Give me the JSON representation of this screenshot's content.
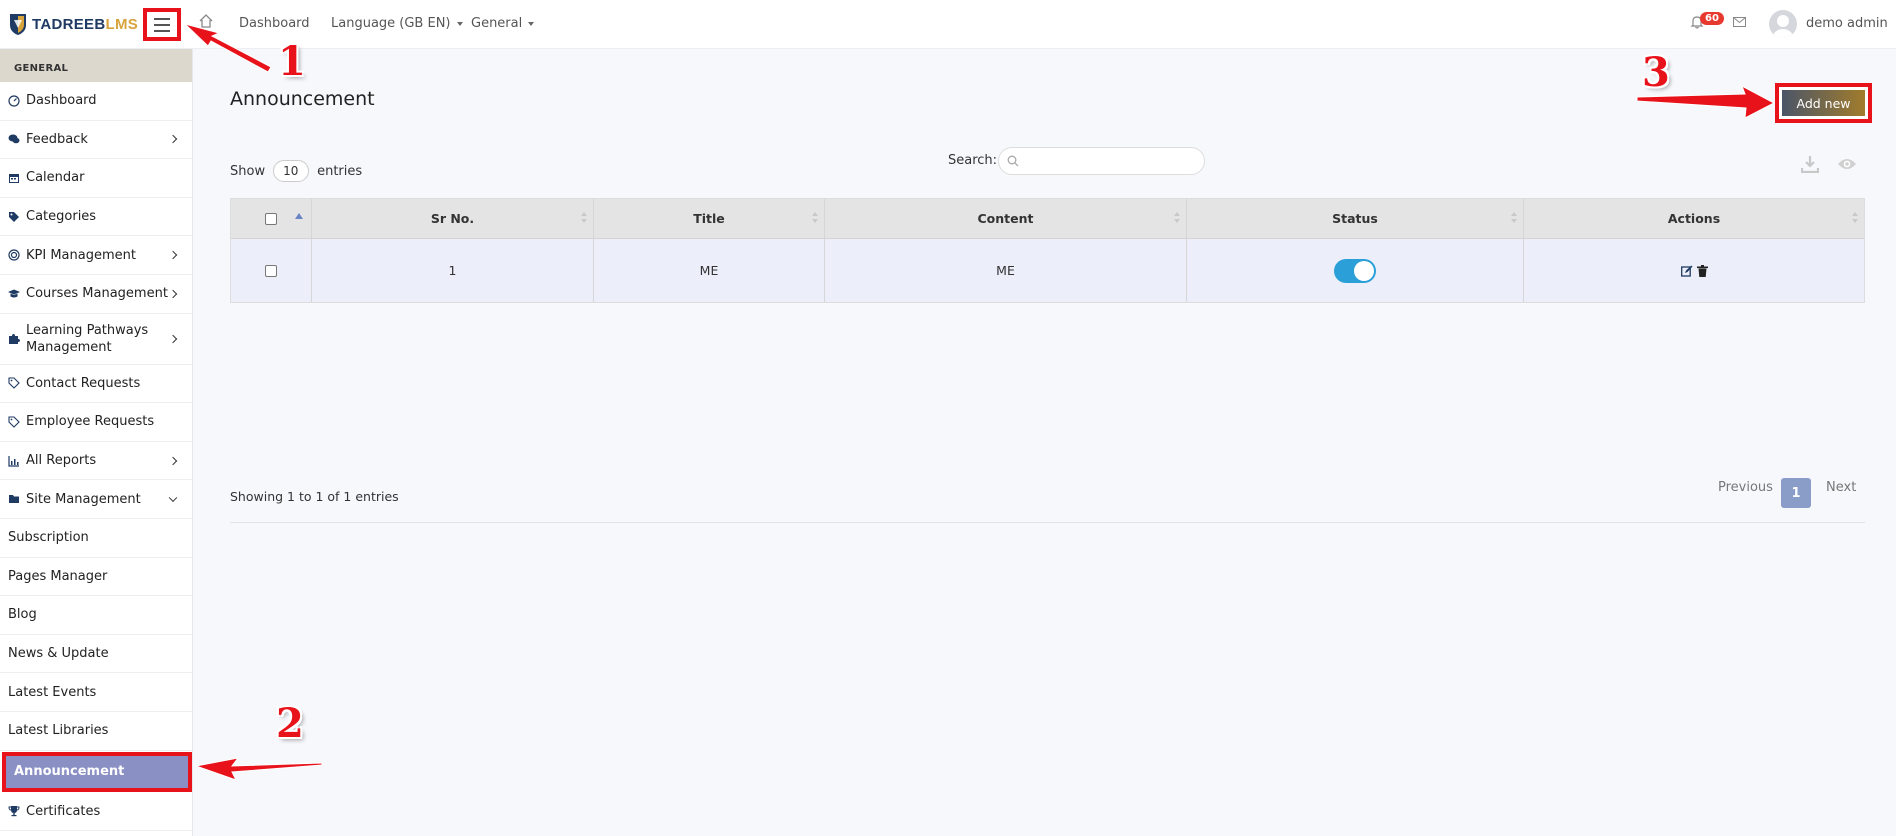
{
  "brand": {
    "part1": "TADREEB",
    "part2": "LMS"
  },
  "topnav": {
    "items": [
      "Dashboard",
      "Language (GB EN)",
      "General"
    ],
    "notifications_count": "60",
    "user_name": "demo admin"
  },
  "sidebar": {
    "section": "GENERAL",
    "items": [
      {
        "label": "Dashboard",
        "icon": "gauge-icon",
        "submenu": false
      },
      {
        "label": "Feedback",
        "icon": "comments-icon",
        "submenu": true
      },
      {
        "label": "Calendar",
        "icon": "calendar-icon",
        "submenu": false
      },
      {
        "label": "Categories",
        "icon": "tags-icon",
        "submenu": false
      },
      {
        "label": "KPI Management",
        "icon": "target-icon",
        "submenu": true
      },
      {
        "label": "Courses Management",
        "icon": "graduation-cap-icon",
        "submenu": true
      },
      {
        "label": "Learning Pathways Management",
        "icon": "puzzle-icon",
        "submenu": true
      },
      {
        "label": "Contact Requests",
        "icon": "tag-icon",
        "submenu": false
      },
      {
        "label": "Employee Requests",
        "icon": "tag-icon",
        "submenu": false
      },
      {
        "label": "All Reports",
        "icon": "chart-icon",
        "submenu": true
      },
      {
        "label": "Site Management",
        "icon": "folder-icon",
        "submenu": true,
        "expanded": true
      },
      {
        "label": "Subscription"
      },
      {
        "label": "Pages Manager"
      },
      {
        "label": "Blog"
      },
      {
        "label": "News & Update"
      },
      {
        "label": "Latest Events"
      },
      {
        "label": "Latest Libraries"
      },
      {
        "label": "Announcement",
        "active": true
      },
      {
        "label": "Certificates",
        "icon": "trophy-icon"
      }
    ]
  },
  "page": {
    "title": "Announcement",
    "add_new_label": "Add new",
    "show_label": "Show",
    "entries_value": "10",
    "entries_label": "entries",
    "search_label": "Search:",
    "search_value": ""
  },
  "table": {
    "columns": [
      "Sr No.",
      "Title",
      "Content",
      "Status",
      "Actions"
    ],
    "rows": [
      {
        "sr": "1",
        "title": "ME",
        "content": "ME",
        "status_on": true
      }
    ]
  },
  "footer": {
    "info": "Showing 1 to 1 of 1 entries",
    "previous": "Previous",
    "page": "1",
    "next": "Next"
  },
  "annotations": {
    "a1": "1",
    "a2": "2",
    "a3": "3"
  },
  "colors": {
    "accent_red": "#e8121b",
    "active_item": "#8a8fc4",
    "toggle": "#2a9fd8",
    "badge": "#e8392f"
  }
}
